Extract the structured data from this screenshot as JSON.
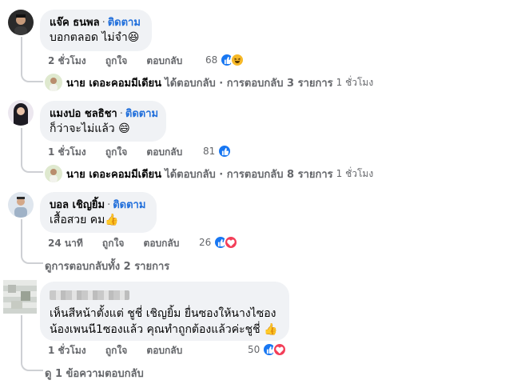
{
  "follow_label": "ติดตาม",
  "like_label": "ถูกใจ",
  "reply_label": "ตอบกลับ",
  "comments": [
    {
      "author": "แจ๊ค ธนพล",
      "text": "บอกตลอด ไม่จำ",
      "emoji": "😆",
      "time": "2 ชั่วโมง",
      "reactions_count": "68",
      "reply_summary": {
        "author": "นาย เดอะคอมมีเดียน",
        "text": "ได้ตอบกลับ · การตอบกลับ 3 รายการ",
        "time": "1 ชั่วโมง"
      }
    },
    {
      "author": "แมงปอ ชลธิชา",
      "text": "ก็ว่าจะไม่แล้ว",
      "emoji": "😄",
      "time": "1 ชั่วโมง",
      "reactions_count": "81",
      "reply_summary": {
        "author": "นาย เดอะคอมมีเดียน",
        "text": "ได้ตอบกลับ · การตอบกลับ 8 รายการ",
        "time": "1 ชั่วโมง"
      }
    },
    {
      "author": "บอล เชิญยิ้ม",
      "text": "เสื้อสวย คม",
      "emoji": "👍",
      "time": "24 นาที",
      "reactions_count": "26",
      "view_more": "ดูการตอบกลับทั้ง 2 รายการ"
    },
    {
      "author": "",
      "text_line1": "เห็นสีหน้าตั้งแต่ ชูชี่ เชิญยิ้ม ยื่นซองให้นางไซอง",
      "text_line2": "น้องเพนนี1ซองแล้ว คุณทำถูกต้องแล้วค่ะชูชี่",
      "emoji": "👍",
      "time": "1 ชั่วโมง",
      "reactions_count": "50",
      "view_more": "ดู 1 ข้อความตอบกลับ"
    }
  ],
  "colors": {
    "like_blue": "#1877f2",
    "love_red": "#f33e58",
    "haha_yellow": "#f7b928",
    "follow_blue": "#216fdb",
    "bubble_bg": "#f0f2f5"
  }
}
